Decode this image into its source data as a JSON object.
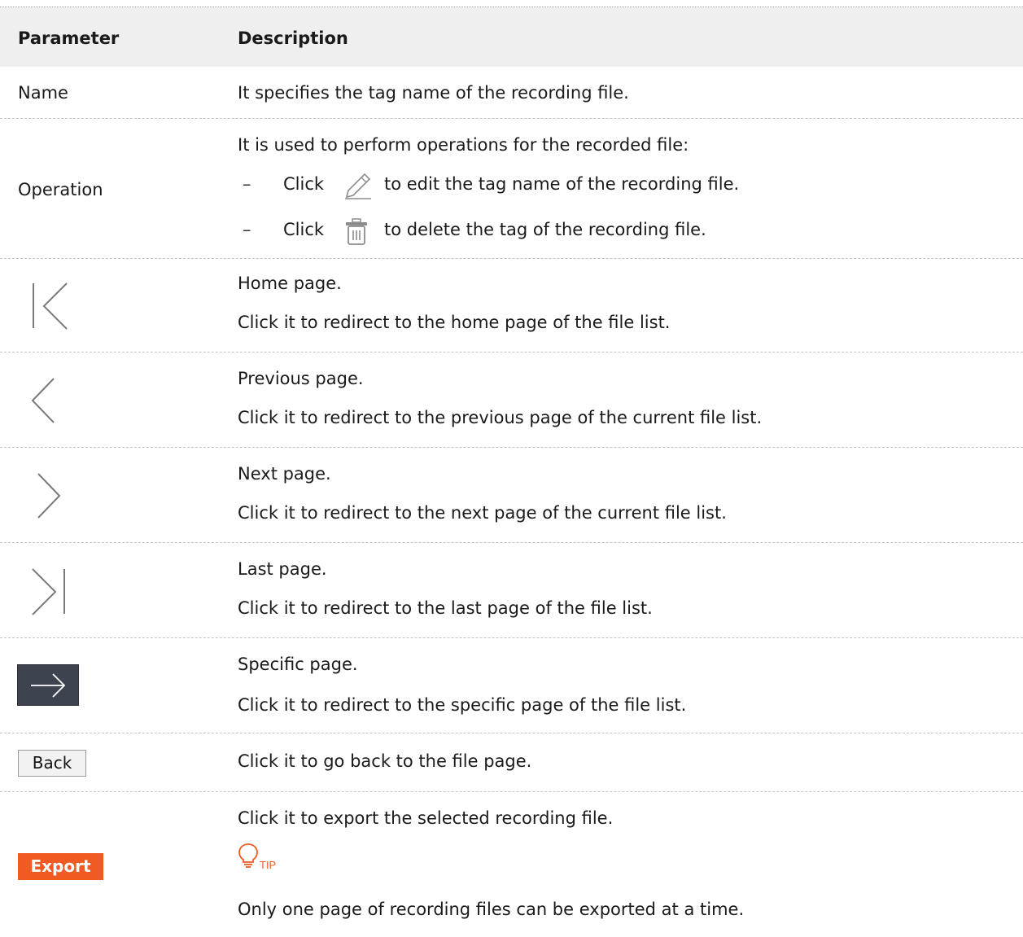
{
  "header": {
    "col1": "Parameter",
    "col2": "Description"
  },
  "rows": {
    "name": {
      "param": "Name",
      "desc": "It specifies the tag name of the recording file."
    },
    "operation": {
      "param": "Operation",
      "desc": "It is used to perform operations for the recorded file:",
      "items": [
        {
          "dash": "–",
          "click": "Click",
          "icon": "pencil-icon",
          "text": "to edit the tag name of the recording file."
        },
        {
          "dash": "–",
          "click": "Click",
          "icon": "trash-icon",
          "text": "to delete the tag of the recording file."
        }
      ]
    },
    "home": {
      "icon": "first-page-icon",
      "title": "Home page.",
      "desc": "Click it to redirect to the home page of the file list."
    },
    "prev": {
      "icon": "previous-page-icon",
      "title": "Previous page.",
      "desc": "Click it to redirect to the previous page of the current file list."
    },
    "next": {
      "icon": "next-page-icon",
      "title": "Next page.",
      "desc": "Click it to redirect to the next page of the current file list."
    },
    "last": {
      "icon": "last-page-icon",
      "title": "Last page.",
      "desc": "Click it to redirect to the last page of the file list."
    },
    "specific": {
      "icon": "arrow-right-icon",
      "title": "Specific page.",
      "desc": "Click it to redirect to the specific page of the file list."
    },
    "back": {
      "button": "Back",
      "desc": "Click it to go back to the file page."
    },
    "export": {
      "button": "Export",
      "desc": "Click it to export the selected recording file.",
      "tip_label": "TIP",
      "tip_text": "Only one page of recording files can be exported at a time."
    }
  },
  "colors": {
    "accent": "#f15a22",
    "dark_button": "#3d4450",
    "header_bg": "#efefef"
  }
}
